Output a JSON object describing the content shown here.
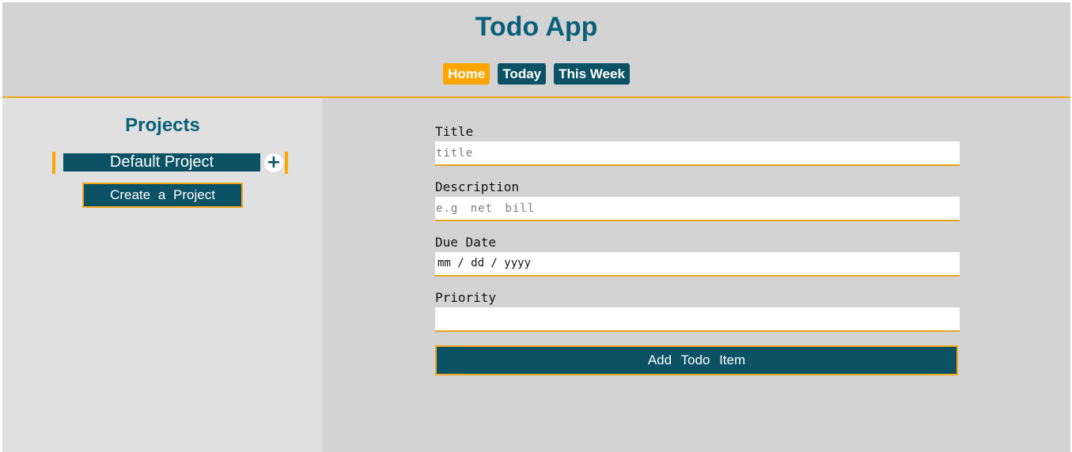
{
  "header": {
    "title": "Todo App",
    "nav": [
      "Home",
      "Today",
      "This Week"
    ],
    "active_nav": "Home"
  },
  "sidebar": {
    "title": "Projects",
    "projects": [
      {
        "name": "Default Project"
      }
    ],
    "add_icon": "+",
    "create_button": "Create a Project"
  },
  "form": {
    "title_label": "Title",
    "title_placeholder": "title",
    "description_label": "Description",
    "description_placeholder": "e.g net bill",
    "due_date_label": "Due Date",
    "due_date_format": "mm / dd / yyyy",
    "priority_label": "Priority",
    "priority_value": "",
    "submit_button": "Add Todo Item"
  },
  "colors": {
    "accent": "#ffa500",
    "primary": "#0b5265",
    "title": "#0b6079",
    "background": "#d3d3d3",
    "sidebar": "#e0e0e0"
  }
}
